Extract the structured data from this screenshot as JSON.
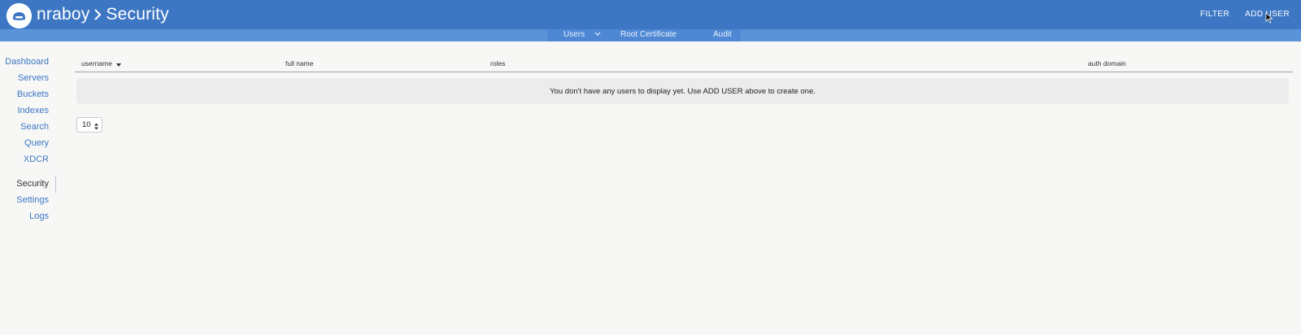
{
  "header": {
    "breadcrumb_root": "nraboy",
    "breadcrumb_page": "Security",
    "filter_label": "FILTER",
    "add_user_label": "ADD USER"
  },
  "subnav": {
    "tabs": [
      {
        "label": "Users",
        "has_dropdown": true
      },
      {
        "label": "Root Certificate"
      },
      {
        "label": "Audit"
      }
    ]
  },
  "sidebar": {
    "items": [
      {
        "label": "Dashboard"
      },
      {
        "label": "Servers"
      },
      {
        "label": "Buckets"
      },
      {
        "label": "Indexes"
      },
      {
        "label": "Search"
      },
      {
        "label": "Query"
      },
      {
        "label": "XDCR"
      },
      {
        "label": "Security",
        "active": true
      },
      {
        "label": "Settings"
      },
      {
        "label": "Logs"
      }
    ]
  },
  "table": {
    "columns": [
      "username",
      "full name",
      "roles",
      "auth domain"
    ],
    "sorted_column": "username",
    "empty_message": "You don't have any users to display yet. Use ADD USER above to create one."
  },
  "pagination": {
    "page_size": "10"
  },
  "colors": {
    "header_bg": "#3d77c4",
    "subnav_bg": "#5b93d9",
    "link": "#3d77c4",
    "page_bg": "#f7f7f6"
  }
}
